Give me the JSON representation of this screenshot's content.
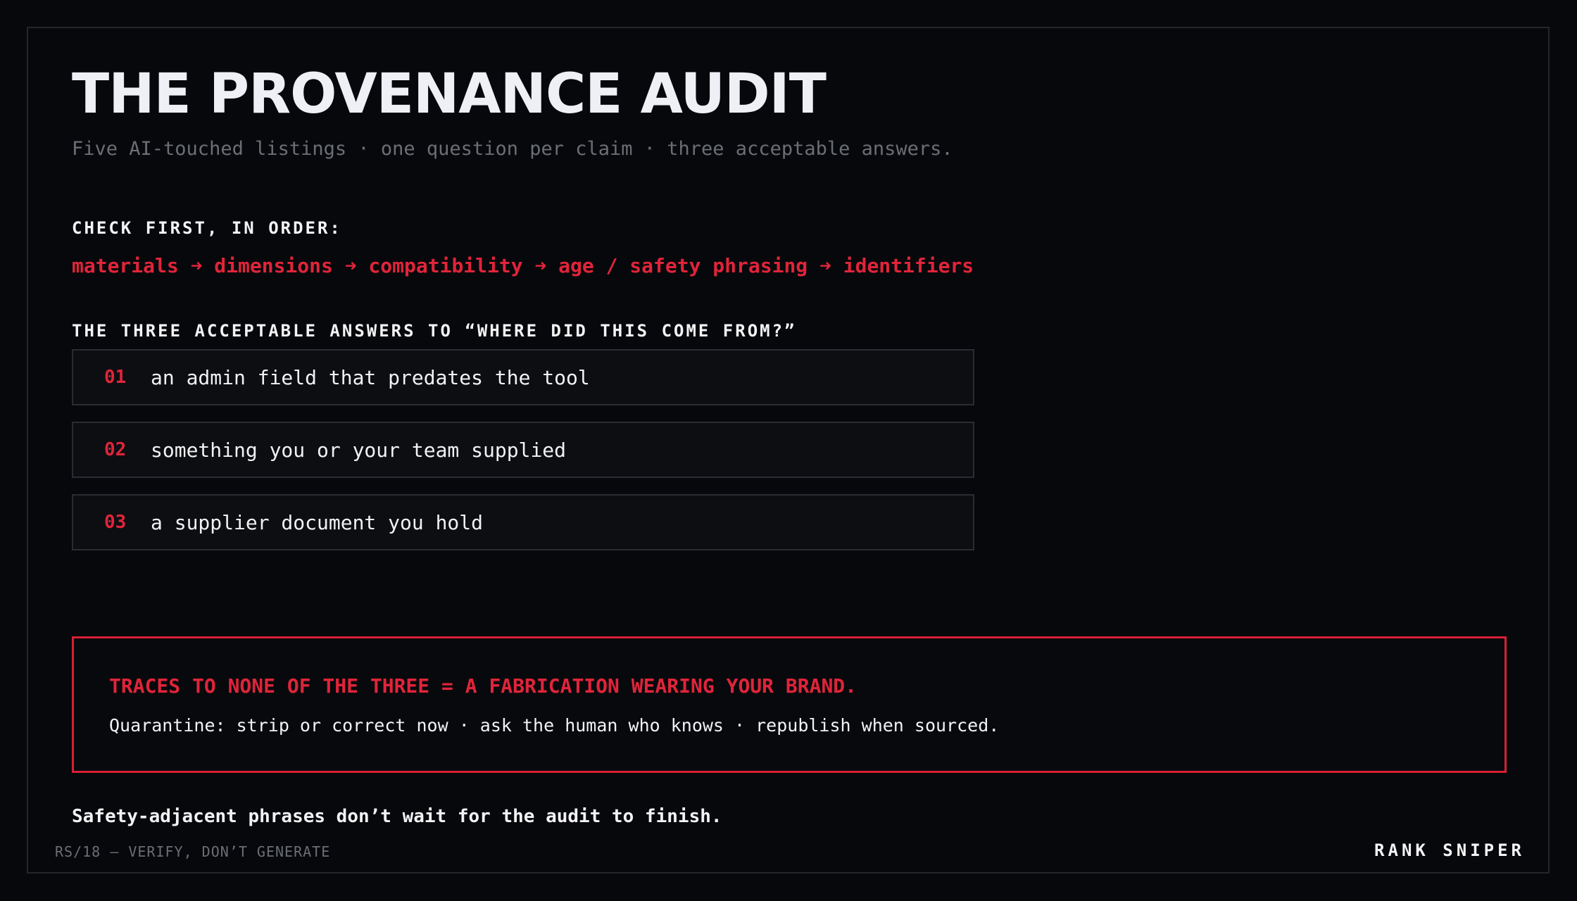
{
  "title": "THE PROVENANCE AUDIT",
  "subtitle": "Five AI-touched listings · one question per claim · three acceptable answers.",
  "check_first": {
    "heading": "CHECK FIRST, IN ORDER:",
    "order": "materials ➜ dimensions ➜ compatibility ➜ age / safety phrasing ➜ identifiers"
  },
  "answers": {
    "heading": "THE THREE ACCEPTABLE ANSWERS TO “WHERE DID THIS COME FROM?”",
    "items": [
      {
        "number": "01",
        "text": "an admin field that predates the tool"
      },
      {
        "number": "02",
        "text": "something you or your team supplied"
      },
      {
        "number": "03",
        "text": "a supplier document you hold"
      }
    ]
  },
  "callout": {
    "headline": "TRACES TO NONE OF THE THREE = A FABRICATION WEARING YOUR BRAND.",
    "body": "Quarantine: strip or correct now · ask the human who knows · republish when sourced."
  },
  "footnote": "Safety-adjacent phrases don’t wait for the audit to finish.",
  "footer": {
    "left": "RS/18 — VERIFY, DON’T GENERATE",
    "right": "RANK SNIPER"
  },
  "colors": {
    "background": "#07080b",
    "accent": "#e0243a",
    "text": "#f2f2f4",
    "muted": "#6b6e75"
  }
}
